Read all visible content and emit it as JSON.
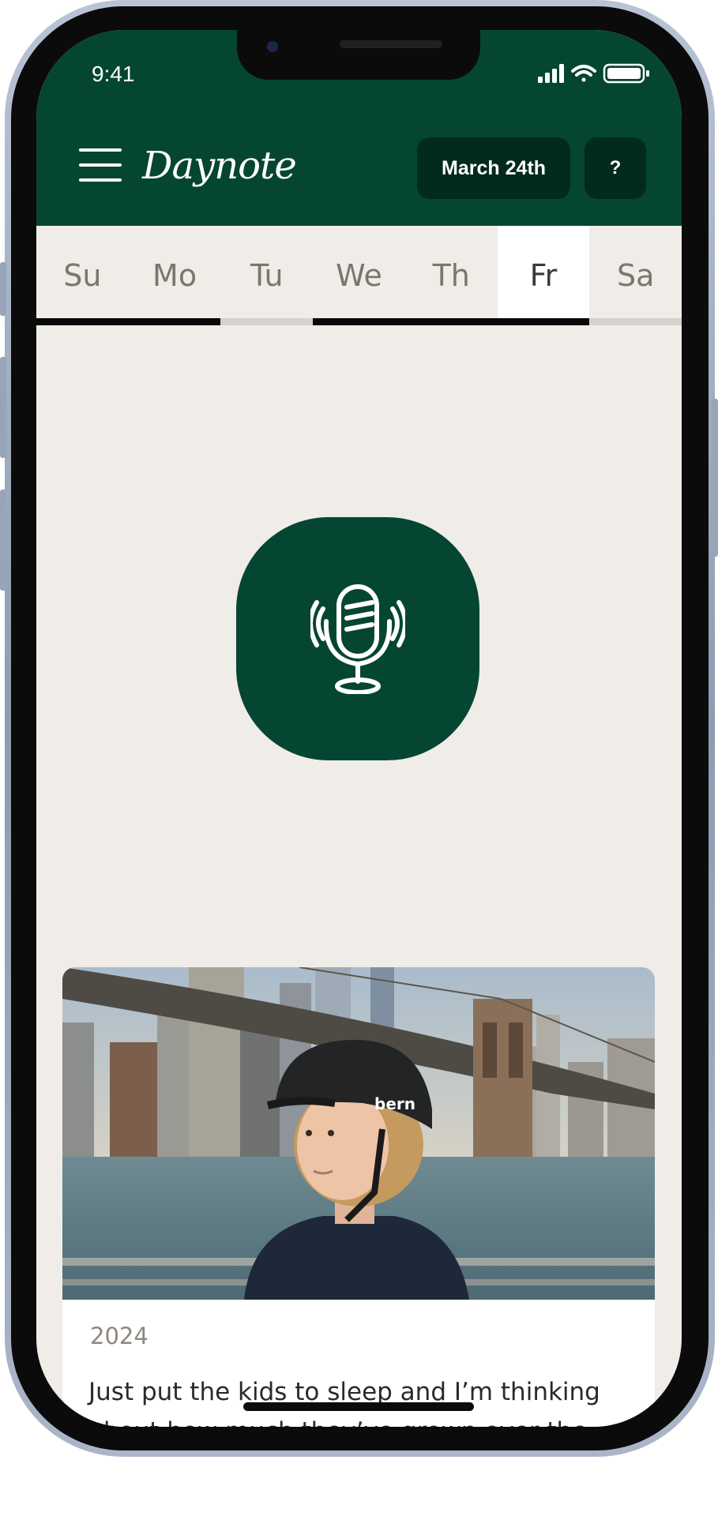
{
  "status_bar": {
    "time": "9:41"
  },
  "header": {
    "app_name": "Daynote",
    "date_label": "March 24th",
    "help_label": "?",
    "background_color": "#054632",
    "button_color": "#022a1d"
  },
  "days": {
    "items": [
      {
        "label": "Su",
        "completed": true
      },
      {
        "label": "Mo",
        "completed": true
      },
      {
        "label": "Tu",
        "completed": false
      },
      {
        "label": "We",
        "completed": true
      },
      {
        "label": "Th",
        "completed": true
      },
      {
        "label": "Fr",
        "completed": true
      },
      {
        "label": "Sa",
        "completed": false
      }
    ],
    "active_label": "Fr"
  },
  "record": {
    "icon": "microphone-icon"
  },
  "memory_card": {
    "year": "2024",
    "text": "Just put the kids to sleep and I’m thinking about how much they’ve grown over the"
  }
}
